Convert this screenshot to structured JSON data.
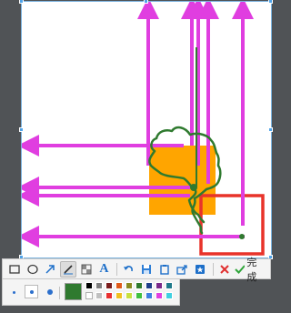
{
  "canvas": {
    "background": "#ffffff"
  },
  "drawing": {
    "arrow_color": "#e03ee0",
    "orange_rect_color": "#ffa500",
    "red_rect_color": "#e8332a",
    "pen_color": "#2f7a2f"
  },
  "toolbar": {
    "tools": [
      {
        "id": "rect",
        "icon": "rectangle-icon"
      },
      {
        "id": "ellipse",
        "icon": "ellipse-icon"
      },
      {
        "id": "arrow",
        "icon": "arrow-icon"
      },
      {
        "id": "pen",
        "icon": "pen-icon",
        "active": true
      },
      {
        "id": "mosaic",
        "icon": "mosaic-icon"
      },
      {
        "id": "text",
        "icon": "text-icon",
        "label": "A"
      },
      {
        "id": "undo",
        "icon": "undo-icon"
      },
      {
        "id": "save",
        "icon": "save-icon"
      },
      {
        "id": "copy",
        "icon": "clipboard-icon"
      },
      {
        "id": "share",
        "icon": "share-icon"
      },
      {
        "id": "pin",
        "icon": "pin-icon"
      },
      {
        "id": "cancel",
        "icon": "close-icon"
      },
      {
        "id": "done",
        "icon": "check-icon"
      }
    ],
    "done_label": "完成"
  },
  "subbar": {
    "brush_sizes": [
      "small",
      "medium",
      "large"
    ],
    "selected_size": "medium",
    "current_color": "#2f7a2f",
    "palette": [
      "#000000",
      "#808080",
      "#7a1c1c",
      "#e05a1a",
      "#8a8a20",
      "#2f7a2f",
      "#1f3f8a",
      "#7a2a8a",
      "#1f7a8a",
      "#ffffff",
      "#c0c0c0",
      "#e83030",
      "#f0c020",
      "#c8e040",
      "#40c040",
      "#4080e0",
      "#e040e0",
      "#40d0e0"
    ]
  }
}
